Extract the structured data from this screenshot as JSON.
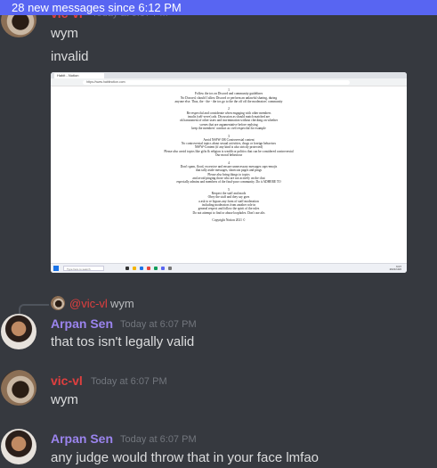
{
  "banner": {
    "text": "28 new messages since 6:12 PM"
  },
  "messages": [
    {
      "author": "vic-vl",
      "timestamp": "Today at 6:07 PM",
      "lines": [
        "wym",
        "invalid"
      ],
      "color": "#e03f3f",
      "attachment": {
        "browser_tab": "Habit - Notion",
        "url": "https://www.habitnotion.com",
        "doc_lines": [
          "1",
          "Follow the tos on Discord and community guidelines",
          "No Doxxed, should I allow Discord or perform an unlawful sharing, during",
          "anyone else. Thus, the - the - the tos go to the the off off the moderators' community",
          "",
          "2",
          "Be respectful and considerate when engaging with other members",
          "insults (self-serve) ads. Discussion as should match matched are",
          "ok harassment of other users and incrimination without checking on whether",
          "scenes that are argumentative before replying",
          "keep the members' conduct as civil respectful for example",
          "",
          "3",
          "Avoid NSFW OR Controversial content",
          "No controversial topics about sexual activities, drugs or foreign behaviors",
          "NSFW-Content (if any kind is also strictly protected)",
          "Please also avoid topics like gifts & religion is wealth or politics that can be considered controversial",
          "Our moral behaviour",
          "",
          "4",
          "Don't spam, flood, excessive and ensure unnecessary messages caps-emojis",
          "that tally aside messages, shortcuts pages and pings",
          "Please also bring things to topics",
          "and avoid pinging those who are not actively on the chat",
          "especially admins and members of the final-poor community. Do it ADHERE TO",
          "",
          "5",
          "Respect the staff and mods",
          "Obey the staff and they say goes",
          "a ask to re bypass any form of staff moderation",
          "including moderators from another role in",
          "general respect and follow the spirit of the rules",
          "Do not attempt to find or abuse loopholes. Don't use alts",
          "",
          "Copyright Notion 2021 ©"
        ],
        "taskbar_search": "Type here to search",
        "tray_lines": [
          "6:07",
          "2021/10/2"
        ]
      }
    },
    {
      "reply_to": {
        "author": "@vic-vl",
        "text": "wym"
      },
      "author": "Arpan Sen",
      "timestamp": "Today at 6:07 PM",
      "lines": [
        "that tos isn't legally valid"
      ],
      "color": "#9b84ee"
    },
    {
      "author": "vic-vl",
      "timestamp": "Today at 6:07 PM",
      "lines": [
        "wym"
      ],
      "color": "#e03f3f"
    },
    {
      "author": "Arpan Sen",
      "timestamp": "Today at 6:07 PM",
      "lines": [
        "any judge would throw that in your face lmfao"
      ],
      "color": "#9b84ee"
    }
  ]
}
